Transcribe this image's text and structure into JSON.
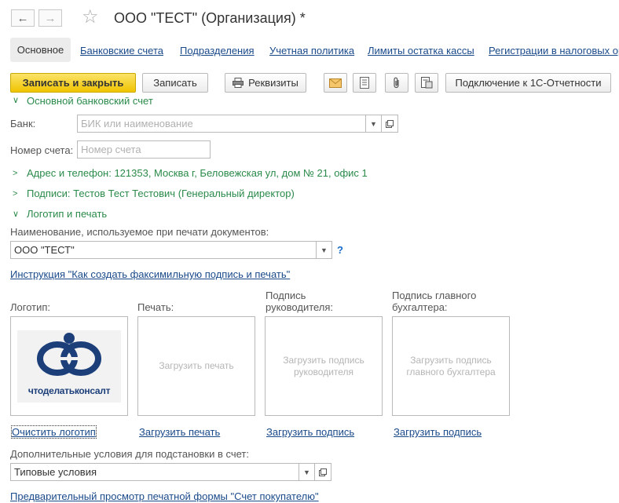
{
  "window": {
    "title": "ООО \"ТЕСТ\" (Организация) *"
  },
  "tabs": [
    {
      "label": "Основное"
    },
    {
      "label": "Банковские счета"
    },
    {
      "label": "Подразделения"
    },
    {
      "label": "Учетная политика"
    },
    {
      "label": "Лимиты остатка кассы"
    },
    {
      "label": "Регистрации в налоговых ор"
    }
  ],
  "toolbar": {
    "save_close": "Записать и закрыть",
    "save": "Записать",
    "requisites": "Реквизиты",
    "connect": "Подключение к 1С-Отчетности"
  },
  "form": {
    "bank_section": "Основной банковский счет",
    "bank_label": "Банк:",
    "bank_placeholder": "БИК или наименование",
    "account_label": "Номер счета:",
    "account_placeholder": "Номер счета",
    "address_section": "Адрес и телефон: 121353, Москва г, Беловежская ул, дом № 21, офис 1",
    "signatures_section": "Подписи: Тестов Тест Тестович (Генеральный директор)",
    "logo_section": "Логотип и печать",
    "print_name_label": "Наименование, используемое при печати документов:",
    "print_name_value": "ООО \"ТЕСТ\"",
    "help_mark": "?",
    "instruction_link": "Инструкция \"Как создать факсимильную подпись и печать\"",
    "logo_label": "Логотип:",
    "stamp_label": "Печать:",
    "head_sign_label": "Подпись руководителя:",
    "chief_acc_label": "Подпись главного бухгалтера:",
    "logo_text": "чтоделатьконсалт",
    "stamp_placeholder": "Загрузить печать",
    "head_sign_placeholder": "Загрузить подпись руководителя",
    "chief_acc_placeholder": "Загрузить подпись главного бухгалтера",
    "clear_logo": "Очистить логотип",
    "load_stamp": "Загрузить печать",
    "load_sign_head": "Загрузить подпись",
    "load_sign_chief": "Загрузить подпись",
    "extra_terms_label": "Дополнительные условия для подстановки в счет:",
    "extra_terms_value": "Типовые условия",
    "preview_link": "Предварительный просмотр печатной формы \"Счет покупателю\""
  },
  "colors": {
    "accent_yellow": "#f5d000",
    "section_green": "#2a8a4a",
    "link_blue": "#1a4a8a",
    "logo_blue": "#1c3f7a"
  }
}
